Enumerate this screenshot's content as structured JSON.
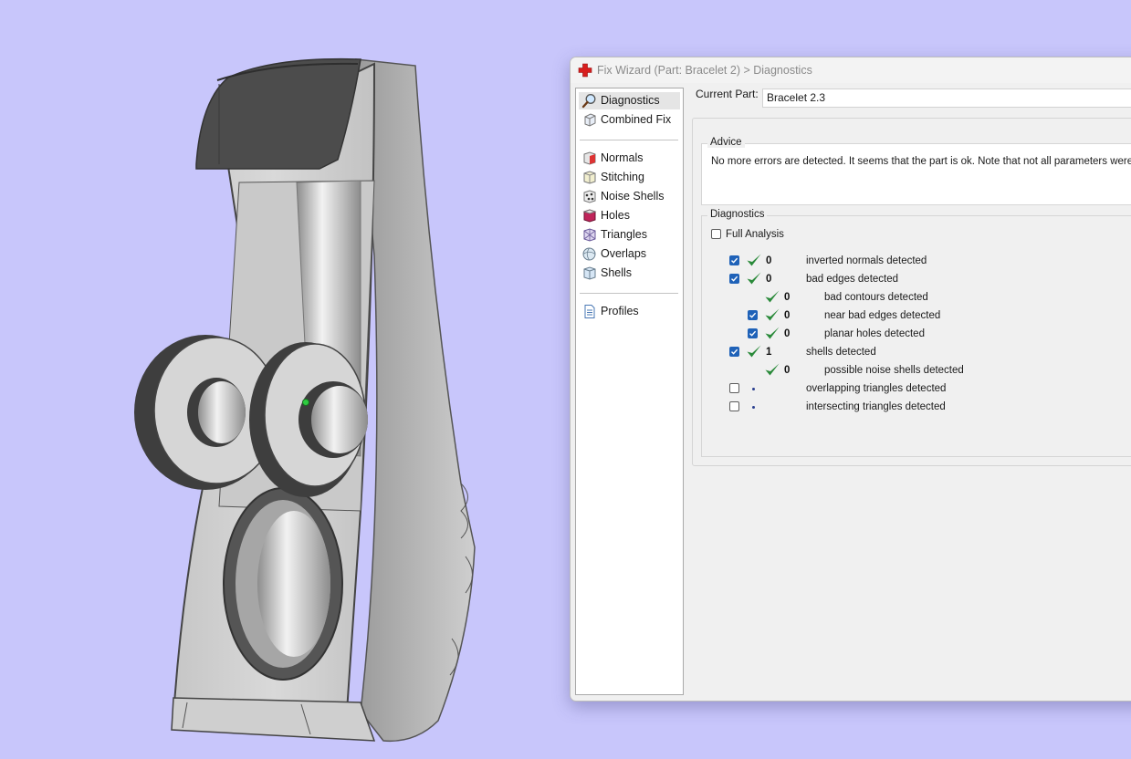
{
  "window": {
    "title": "Fix Wizard (Part: Bracelet 2) > Diagnostics"
  },
  "sidebar": {
    "groups": [
      {
        "items": [
          {
            "label": "Diagnostics",
            "icon": "magnifier-icon",
            "selected": true
          },
          {
            "label": "Combined Fix",
            "icon": "combined-fix-icon",
            "selected": false
          }
        ]
      },
      {
        "items": [
          {
            "label": "Normals",
            "icon": "normals-icon",
            "selected": false
          },
          {
            "label": "Stitching",
            "icon": "stitching-icon",
            "selected": false
          },
          {
            "label": "Noise Shells",
            "icon": "noise-shells-icon",
            "selected": false
          },
          {
            "label": "Holes",
            "icon": "holes-icon",
            "selected": false
          },
          {
            "label": "Triangles",
            "icon": "triangles-icon",
            "selected": false
          },
          {
            "label": "Overlaps",
            "icon": "overlaps-icon",
            "selected": false
          },
          {
            "label": "Shells",
            "icon": "shells-icon",
            "selected": false
          }
        ]
      },
      {
        "items": [
          {
            "label": "Profiles",
            "icon": "profiles-icon",
            "selected": false
          }
        ]
      }
    ]
  },
  "current_part": {
    "label": "Current Part:",
    "value": "Bracelet 2.3"
  },
  "advice": {
    "title": "Advice",
    "text": "No more errors are detected. It seems that the part is ok. Note that not all parameters were an"
  },
  "diagnostics": {
    "title": "Diagnostics",
    "full_analysis_label": "Full Analysis",
    "full_analysis_checked": false,
    "rows": [
      {
        "checkbox": true,
        "checked": true,
        "status": "ok",
        "count": "0",
        "label": "inverted normals detected",
        "indent": 0
      },
      {
        "checkbox": true,
        "checked": true,
        "status": "ok",
        "count": "0",
        "label": "bad edges detected",
        "indent": 0
      },
      {
        "checkbox": false,
        "checked": false,
        "status": "ok",
        "count": "0",
        "label": "bad contours detected",
        "indent": 1
      },
      {
        "checkbox": true,
        "checked": true,
        "status": "ok",
        "count": "0",
        "label": "near bad edges detected",
        "indent": 1
      },
      {
        "checkbox": true,
        "checked": true,
        "status": "ok",
        "count": "0",
        "label": "planar holes detected",
        "indent": 1
      },
      {
        "checkbox": true,
        "checked": true,
        "status": "ok",
        "count": "1",
        "label": "shells detected",
        "indent": 0
      },
      {
        "checkbox": false,
        "checked": false,
        "status": "ok",
        "count": "0",
        "label": "possible noise shells detected",
        "indent": 1
      },
      {
        "checkbox": true,
        "checked": false,
        "status": "pending",
        "count": "",
        "label": "overlapping triangles detected",
        "indent": 0
      },
      {
        "checkbox": true,
        "checked": false,
        "status": "pending",
        "count": "",
        "label": "intersecting triangles detected",
        "indent": 0
      }
    ]
  },
  "colors": {
    "background": "#c8c6fb",
    "model_dark": "#4d4d4d",
    "model_light": "#d0d0d0",
    "tick_green": "#2a8a3a",
    "checkbox_blue": "#1f62b8"
  }
}
